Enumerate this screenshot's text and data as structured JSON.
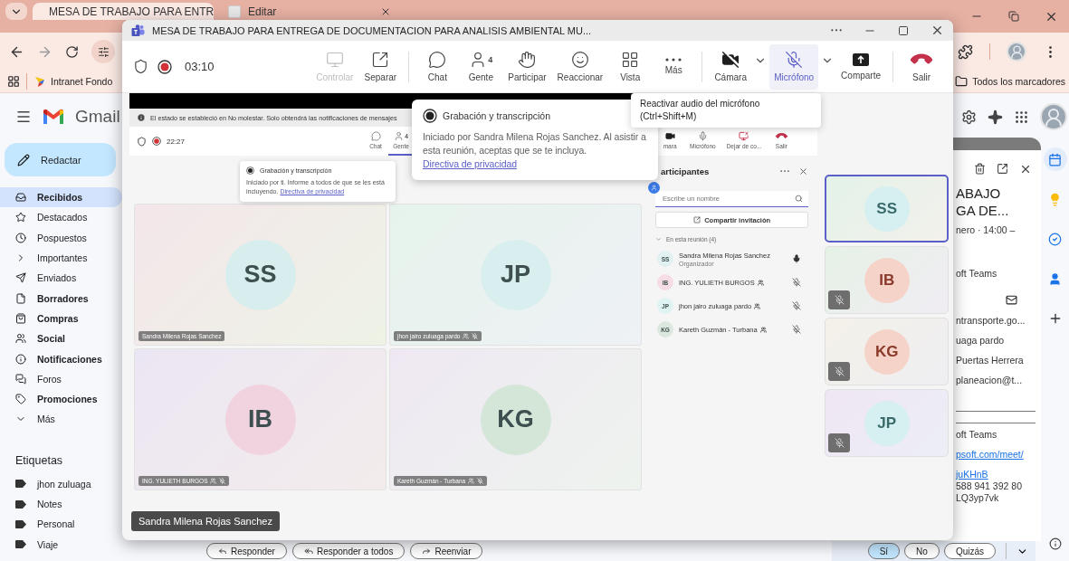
{
  "browser": {
    "tabs": [
      {
        "title": "MESA DE TRABAJO PARA ENTR",
        "selected": true
      },
      {
        "title": "Editar",
        "selected": false
      }
    ],
    "bookmarks": [
      {
        "label": "Intranet Fondo"
      }
    ],
    "all_bookmarks": "Todos los marcadores"
  },
  "gmail": {
    "app_name": "Gmail",
    "compose": "Redactar",
    "folders": [
      {
        "label": "Recibidos",
        "unread": true,
        "selected": true
      },
      {
        "label": "Destacados",
        "unread": false,
        "selected": false
      },
      {
        "label": "Pospuestos",
        "unread": false,
        "selected": false
      },
      {
        "label": "Importantes",
        "unread": false,
        "selected": false
      },
      {
        "label": "Enviados",
        "unread": false,
        "selected": false
      },
      {
        "label": "Borradores",
        "unread": true,
        "selected": false
      },
      {
        "label": "Compras",
        "unread": true,
        "selected": false
      },
      {
        "label": "Social",
        "unread": true,
        "selected": false
      },
      {
        "label": "Notificaciones",
        "unread": true,
        "selected": false
      },
      {
        "label": "Foros",
        "unread": false,
        "selected": false
      },
      {
        "label": "Promociones",
        "unread": true,
        "selected": false
      },
      {
        "label": "Más",
        "unread": false,
        "selected": false
      }
    ],
    "labels_heading": "Etiquetas",
    "labels": [
      "jhon zuluaga",
      "Notes",
      "Personal",
      "Viaje"
    ],
    "event": {
      "title_lines": [
        "ABAJO",
        "GA DE..."
      ],
      "date": "nero · 14:00 –",
      "app": "oft Teams",
      "guests": [
        "ntransporte.go...",
        "uaga pardo",
        "Puertas Herrera",
        "planeacion@t..."
      ],
      "details": [
        {
          "text": "oft Teams",
          "kind": "text"
        },
        {
          "text": "psoft.com/meet/",
          "kind": "link"
        },
        {
          "text": "juKHnB",
          "kind": "link"
        },
        {
          "text": "588 941 392 80",
          "kind": "text"
        },
        {
          "text": "LQ3yp7vk",
          "kind": "text"
        }
      ]
    },
    "message_actions": [
      {
        "label": "Responder",
        "kind": "reply"
      },
      {
        "label": "Responder a todos",
        "kind": "reply-all"
      },
      {
        "label": "Reenviar",
        "kind": "forward"
      }
    ],
    "rsvp": [
      {
        "label": "Sí",
        "selected": true
      },
      {
        "label": "No",
        "selected": false
      },
      {
        "label": "Quizás",
        "selected": false
      }
    ]
  },
  "teams": {
    "title": "MESA DE TRABAJO PARA ENTREGA DE DOCUMENTACION PARA ANALISIS AMBIENTAL MU...",
    "timer": "03:10",
    "toolbar_groups": [
      {
        "buttons": [
          {
            "label": "Controlar",
            "kind": "control",
            "disabled": true,
            "selected": false
          },
          {
            "label": "Separar",
            "kind": "popout",
            "disabled": false,
            "selected": false
          }
        ]
      },
      {
        "buttons": [
          {
            "label": "Chat",
            "kind": "chat",
            "disabled": false,
            "selected": false
          },
          {
            "label": "Gente",
            "kind": "people",
            "count": "4",
            "disabled": false,
            "selected": false
          },
          {
            "label": "Participar",
            "kind": "hand",
            "disabled": false,
            "selected": false
          },
          {
            "label": "Reaccionar",
            "kind": "emoji",
            "disabled": false,
            "selected": false
          },
          {
            "label": "Vista",
            "kind": "grid",
            "disabled": false,
            "selected": false
          },
          {
            "label": "Más",
            "kind": "more",
            "disabled": false,
            "selected": false
          }
        ]
      },
      {
        "buttons": [
          {
            "label": "Cámara",
            "kind": "camera-off",
            "dropdown": true,
            "disabled": false,
            "selected": false
          },
          {
            "label": "Micrófono",
            "kind": "mic-off",
            "dropdown": true,
            "disabled": false,
            "selected": true
          },
          {
            "label": "Comparte",
            "kind": "share",
            "disabled": false,
            "selected": false
          }
        ]
      },
      {
        "buttons": [
          {
            "label": "Salir",
            "kind": "leave",
            "disabled": false,
            "selected": false
          }
        ]
      }
    ],
    "shared_screen": {
      "notice": "El estado se estableció en No molestar. Solo obtendrá las notificaciones de mensajes",
      "timer": "22:27",
      "toolbar": [
        {
          "label": "Chat",
          "kind": "chat",
          "selected": false
        },
        {
          "label": "Gente",
          "kind": "people",
          "count": "4",
          "selected": true
        },
        {
          "label": "mara",
          "kind": "camera",
          "selected": false
        },
        {
          "label": "Micrófono",
          "kind": "mic",
          "selected": false
        },
        {
          "label": "Dejar de co...",
          "kind": "stop-share",
          "selected": false
        },
        {
          "label": "Salir",
          "kind": "leave",
          "selected": false
        }
      ],
      "popup": {
        "title": "Grabación y transcripción",
        "text": "Iniciado por ti. Informe a todos de que se les está incluyendo.",
        "link": "Directiva de privacidad"
      },
      "tiles": [
        {
          "initials": "SS",
          "name": "Sandra Milena Rojas Sanchez",
          "color": "#d8eeee",
          "guest": false,
          "muted": false
        },
        {
          "initials": "JP",
          "name": "jhon jairo zuluaga pardo",
          "color": "#d9efef",
          "guest": true,
          "muted": true
        },
        {
          "initials": "IB",
          "name": "ING. YULIETH BURGOS",
          "color": "#f0d3de",
          "guest": true,
          "muted": true
        },
        {
          "initials": "KG",
          "name": "Kareth Guzmán - Turbana",
          "color": "#d3e6d8",
          "guest": true,
          "muted": true
        }
      ],
      "panel": {
        "title": "articipantes",
        "search_placeholder": "Escribe un nombre",
        "invite": "Compartir invitación",
        "section": "En esta reunión (4)",
        "participants": [
          {
            "initials": "SS",
            "name": "Sandra Milena Rojas Sanchez",
            "role": "Organizador",
            "color": "#e1f1f1",
            "guest": false,
            "muted": false
          },
          {
            "initials": "IB",
            "name": "ING. YULIETH BURGOS",
            "color": "#f6dde5",
            "guest": true,
            "muted": true
          },
          {
            "initials": "JP",
            "name": "jhon jairo zuluaga pardo",
            "color": "#e0f3f3",
            "guest": true,
            "muted": true
          },
          {
            "initials": "KG",
            "name": "Kareth Guzmán - Turbana",
            "color": "#dce8df",
            "guest": true,
            "muted": true
          }
        ]
      }
    },
    "gallery": [
      {
        "initials": "SS",
        "color": "#d6eff1",
        "selected": true,
        "muted": false
      },
      {
        "initials": "IB",
        "color": "#f5d3c9",
        "selected": false,
        "muted": true
      },
      {
        "initials": "KG",
        "color": "#f5d3c9",
        "selected": false,
        "muted": true
      },
      {
        "initials": "JP",
        "color": "#d6eff1",
        "selected": false,
        "muted": true
      }
    ],
    "speaker_label": "Sandra Milena Rojas Sanchez",
    "recording_popup": {
      "title": "Grabación y transcripción",
      "text": "Iniciado por Sandra Milena Rojas Sanchez. Al asistir a esta reunión, aceptas que se te incluya.",
      "link": "Directiva de privacidad"
    },
    "tooltip": {
      "text": "Reactivar audio del micrófono",
      "shortcut": "(Ctrl+Shift+M)"
    }
  }
}
